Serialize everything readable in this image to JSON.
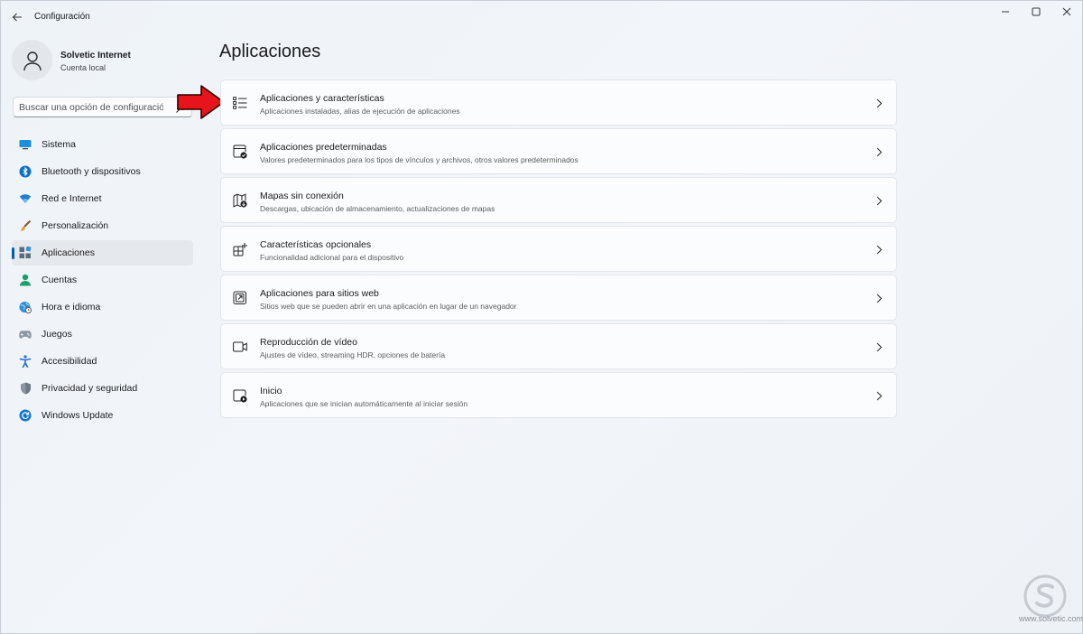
{
  "window": {
    "title": "Configuración"
  },
  "profile": {
    "name": "Solvetic Internet",
    "account_type": "Cuenta local"
  },
  "search": {
    "placeholder": "Buscar una opción de configuración"
  },
  "sidebar": {
    "items": [
      {
        "label": "Sistema",
        "icon": "monitor-icon",
        "active": false
      },
      {
        "label": "Bluetooth y dispositivos",
        "icon": "bluetooth-icon",
        "active": false
      },
      {
        "label": "Red e Internet",
        "icon": "wifi-icon",
        "active": false
      },
      {
        "label": "Personalización",
        "icon": "paintbrush-icon",
        "active": false
      },
      {
        "label": "Aplicaciones",
        "icon": "apps-icon",
        "active": true
      },
      {
        "label": "Cuentas",
        "icon": "person-icon",
        "active": false
      },
      {
        "label": "Hora e idioma",
        "icon": "globe-clock-icon",
        "active": false
      },
      {
        "label": "Juegos",
        "icon": "gamepad-icon",
        "active": false
      },
      {
        "label": "Accesibilidad",
        "icon": "accessibility-icon",
        "active": false
      },
      {
        "label": "Privacidad y seguridad",
        "icon": "shield-icon",
        "active": false
      },
      {
        "label": "Windows Update",
        "icon": "update-icon",
        "active": false
      }
    ]
  },
  "main": {
    "title": "Aplicaciones",
    "cards": [
      {
        "title": "Aplicaciones y características",
        "description": "Aplicaciones instaladas, alias de ejecución de aplicaciones",
        "icon": "app-list-icon"
      },
      {
        "title": "Aplicaciones predeterminadas",
        "description": "Valores predeterminados para los tipos de vínculos y archivos, otros valores predeterminados",
        "icon": "default-apps-icon"
      },
      {
        "title": "Mapas sin conexión",
        "description": "Descargas, ubicación de almacenamiento, actualizaciones de mapas",
        "icon": "offline-map-icon"
      },
      {
        "title": "Características opcionales",
        "description": "Funcionalidad adicional para el dispositivo",
        "icon": "optional-features-icon"
      },
      {
        "title": "Aplicaciones para sitios web",
        "description": "Sitios web que se pueden abrir en una aplicación en lugar de un navegador",
        "icon": "web-apps-icon"
      },
      {
        "title": "Reproducción de vídeo",
        "description": "Ajustes de vídeo, streaming HDR, opciones de batería",
        "icon": "video-icon"
      },
      {
        "title": "Inicio",
        "description": "Aplicaciones que se inician automáticamente al iniciar sesión",
        "icon": "startup-icon"
      }
    ]
  },
  "watermark": {
    "text": "www.solvetic.com"
  },
  "colors": {
    "accent": "#005fb8",
    "annotation_arrow": "#e8141b"
  }
}
